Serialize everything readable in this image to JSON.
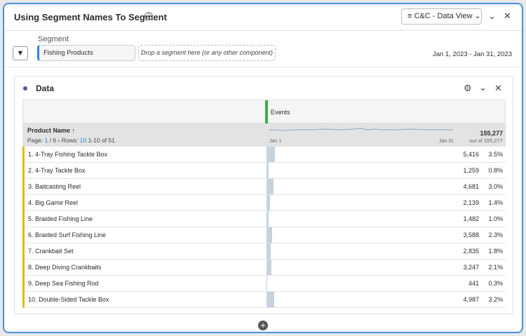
{
  "header": {
    "title": "Using Segment Names To Segment",
    "data_view": "C&C - Data View"
  },
  "segment_bar": {
    "label": "Segment",
    "segment": "Fishing Products",
    "drop_placeholder": "Drop a segment here (or any other component)",
    "date_range": "Jan 1, 2023 - Jan 31, 2023"
  },
  "panel": {
    "title": "Data"
  },
  "table": {
    "metric": "Events",
    "dimension": "Product Name",
    "page_label": "Page:",
    "page": "1",
    "pages": "/ 6",
    "rows_label": "Rows:",
    "rows": "10",
    "range": "1-10 of 51",
    "spark_start": "Jan 1",
    "spark_end": "Jan 31",
    "total": "155,277",
    "total_sub": "out of 155,277",
    "rows_data": [
      {
        "name": "1.  4-Tray Fishing Tackle Box",
        "value": "5,416",
        "pct": "3.5%",
        "share": 3.5
      },
      {
        "name": "2.  4-Tray Tackle Box",
        "value": "1,259",
        "pct": "0.8%",
        "share": 0.8
      },
      {
        "name": "3.  Baitcasting Reel",
        "value": "4,681",
        "pct": "3.0%",
        "share": 3.0
      },
      {
        "name": "4.  Big Game Reel",
        "value": "2,139",
        "pct": "1.4%",
        "share": 1.4
      },
      {
        "name": "5.  Braided Fishing Line",
        "value": "1,482",
        "pct": "1.0%",
        "share": 1.0
      },
      {
        "name": "6.  Braided Surf Fishing Line",
        "value": "3,588",
        "pct": "2.3%",
        "share": 2.3
      },
      {
        "name": "7.  Crankbait Set",
        "value": "2,835",
        "pct": "1.8%",
        "share": 1.8
      },
      {
        "name": "8.  Deep Diving Crankbaits",
        "value": "3,247",
        "pct": "2.1%",
        "share": 2.1
      },
      {
        "name": "9.  Deep Sea Fishing Rod",
        "value": "441",
        "pct": "0.3%",
        "share": 0.3
      },
      {
        "name": "10.  Double-Sided Tackle Box",
        "value": "4,987",
        "pct": "3.2%",
        "share": 3.2
      }
    ]
  }
}
